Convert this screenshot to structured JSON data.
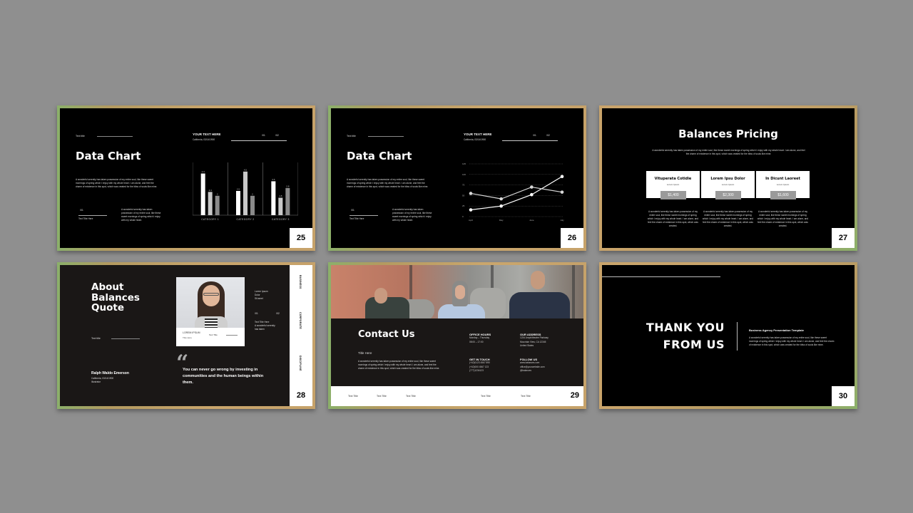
{
  "slides": [
    {
      "number": "25",
      "section_label": "Text title",
      "title": "Data Chart",
      "body": "A wonderful serenity has taken possession of my entire soul, like these sweet mornings of spring which I enjoy with my whole heart. I am alone, and feel the charm of existence in this spot, which was created for the bliss of souls like mine.",
      "stat_value": "/01",
      "stat_label": "Text Title Here",
      "side_text": "A wonderful serenity has taken possession of my entire soul, like these sweet mornings of spring which I enjoy with my whole heart.",
      "chart_header": "YOUR TEXT HERE",
      "chart_sub": "California, 03/14/1900",
      "chart_marks": [
        "/01",
        "/02"
      ]
    },
    {
      "number": "26",
      "section_label": "Text title",
      "title": "Data Chart",
      "body": "A wonderful serenity has taken possession of my entire soul, like these sweet mornings of spring which I enjoy with my whole heart. I am alone, and feel the charm of existence in this spot, which was created for the bliss of souls like mine.",
      "stat_value": "/01",
      "stat_label": "Text Title Here",
      "side_text": "A wonderful serenity has taken possession of my entire soul, like these sweet mornings of spring which I enjoy with my whole heart.",
      "chart_header": "YOUR TEXT HERE",
      "chart_sub": "California, 03/14/1900",
      "chart_marks": [
        "/01",
        "/02"
      ]
    },
    {
      "number": "27",
      "title": "Balances Pricing",
      "intro": "A wonderful serenity has taken possession of my entire soul, like these sweet mornings of spring which I enjoy with my whole heart. I am alone, and feel the charm of existence in this spot, which was created for the bliss of souls like mine.",
      "cards": [
        {
          "name": "Vituperata Cotidie",
          "sub": "Lorem Ipsum",
          "price": "$1,400",
          "desc": "A wonderful serenity has taken possession of my entire soul, like these sweet mornings of spring which I enjoy with my whole heart. I am alone, and feel the charm of existence in this spot, which was created."
        },
        {
          "name": "Lorem Ipsu Dolor",
          "sub": "Lorem Ipsum",
          "price": "$2,300",
          "desc": "A wonderful serenity has taken possession of my entire soul, like these sweet mornings of spring which I enjoy with my whole heart. I am alone, and feel the charm of existence in this spot, which was created."
        },
        {
          "name": "In Dicunt Laoreet",
          "sub": "Lorem Ipsum",
          "price": "$1,600",
          "desc": "A wonderful serenity has taken possession of my entire soul, like these sweet mornings of spring which I enjoy with my whole heart. I am alone, and feel the charm of existence in this spot, which was created."
        }
      ]
    },
    {
      "number": "28",
      "title_lines": [
        "About",
        "Balances",
        "Quote"
      ],
      "section_label": "Text title",
      "author": "Ralph Waldo Emerson",
      "author_sub": "California, 03/14/1900",
      "author_role": "Illustrator",
      "photo_name": "LOREM IPSUM",
      "photo_sub": "Title Here",
      "photo_label": "Text Title",
      "side_lines": [
        "Lorem Ipsum",
        "Dolor",
        "Sit amet"
      ],
      "marks": [
        "/01",
        "/02"
      ],
      "mark_label": "Text Title Here",
      "mark_text": "A wonderful serenity has taken",
      "quote": "You can never go wrong by investing in communities and the human beings within them.",
      "vertical_labels": [
        "BUSINESS",
        "CORPORATE",
        "DISCIPLINE"
      ]
    },
    {
      "number": "29",
      "title": "Contact Us",
      "subtitle": "Title Here",
      "body": "A wonderful serenity has taken possession of my entire soul, like these sweet mornings of spring which I enjoy with my whole heart. I am alone, and feel the charm of existence in this spot, which was created for the bliss of souls like mine.",
      "office_hours": {
        "heading": "OFFICE HOURS",
        "lines": [
          "Monday – Thursday",
          "08:00 – 17:00"
        ]
      },
      "address": {
        "heading": "OUR ADDRESS",
        "lines": [
          "1234 Amphitheatre Parkway",
          "Mountain View, CA 12345",
          "United States"
        ]
      },
      "get_in_touch": {
        "heading": "GET IN TOUCH",
        "lines": [
          "(+62)0123 4567 890",
          "(+62)000 4567 123",
          "(777)1234123"
        ]
      },
      "follow_us": {
        "heading": "FOLLOW US",
        "lines": [
          "www.balances.com",
          "office@yourwebsite.com",
          "@balances"
        ]
      },
      "footer_items": [
        "Text Title",
        "Text Title",
        "Text Title",
        "Text Title",
        "Text Title"
      ]
    },
    {
      "number": "30",
      "title_lines": [
        "THANK YOU",
        "FROM US"
      ],
      "subtitle": "Business Agency Presentation Template",
      "body": "A wonderful serenity has taken possession of my entire soul, like these sweet mornings of spring which I enjoy with my whole heart. I am alone, and feel the charm of existence in this spot, which was created for the bliss of souls like mine."
    }
  ],
  "chart_data": [
    {
      "type": "bar",
      "title": "",
      "categories": [
        "CATEGORY 1",
        "CATEGORY 2",
        "CATEGORY 3"
      ],
      "series": [
        {
          "name": "Series 1",
          "values": [
            4.3,
            2.5,
            3.5
          ],
          "color": "#ffffff"
        },
        {
          "name": "Series 2",
          "values": [
            2.4,
            4.5,
            1.8
          ],
          "color": "#c8c8c8"
        },
        {
          "name": "Series 3",
          "values": [
            2.0,
            2.0,
            2.8
          ],
          "color": "#8a8a8a"
        }
      ],
      "ylim": [
        0,
        5
      ],
      "grid": false,
      "xlabel": "",
      "ylabel": ""
    },
    {
      "type": "line",
      "title": "",
      "x": [
        "April",
        "May",
        "June",
        "July"
      ],
      "y_ticks": [
        0,
        25,
        50,
        75,
        100,
        125
      ],
      "ylim": [
        0,
        125
      ],
      "grid": true,
      "series": [
        {
          "name": "Series 1",
          "values": [
            16,
            25,
            52,
            95
          ],
          "color": "#ffffff"
        },
        {
          "name": "Series 2",
          "values": [
            55,
            42,
            70,
            58
          ],
          "color": "#d8d8d8"
        }
      ],
      "xlabel": "",
      "ylabel": ""
    }
  ]
}
